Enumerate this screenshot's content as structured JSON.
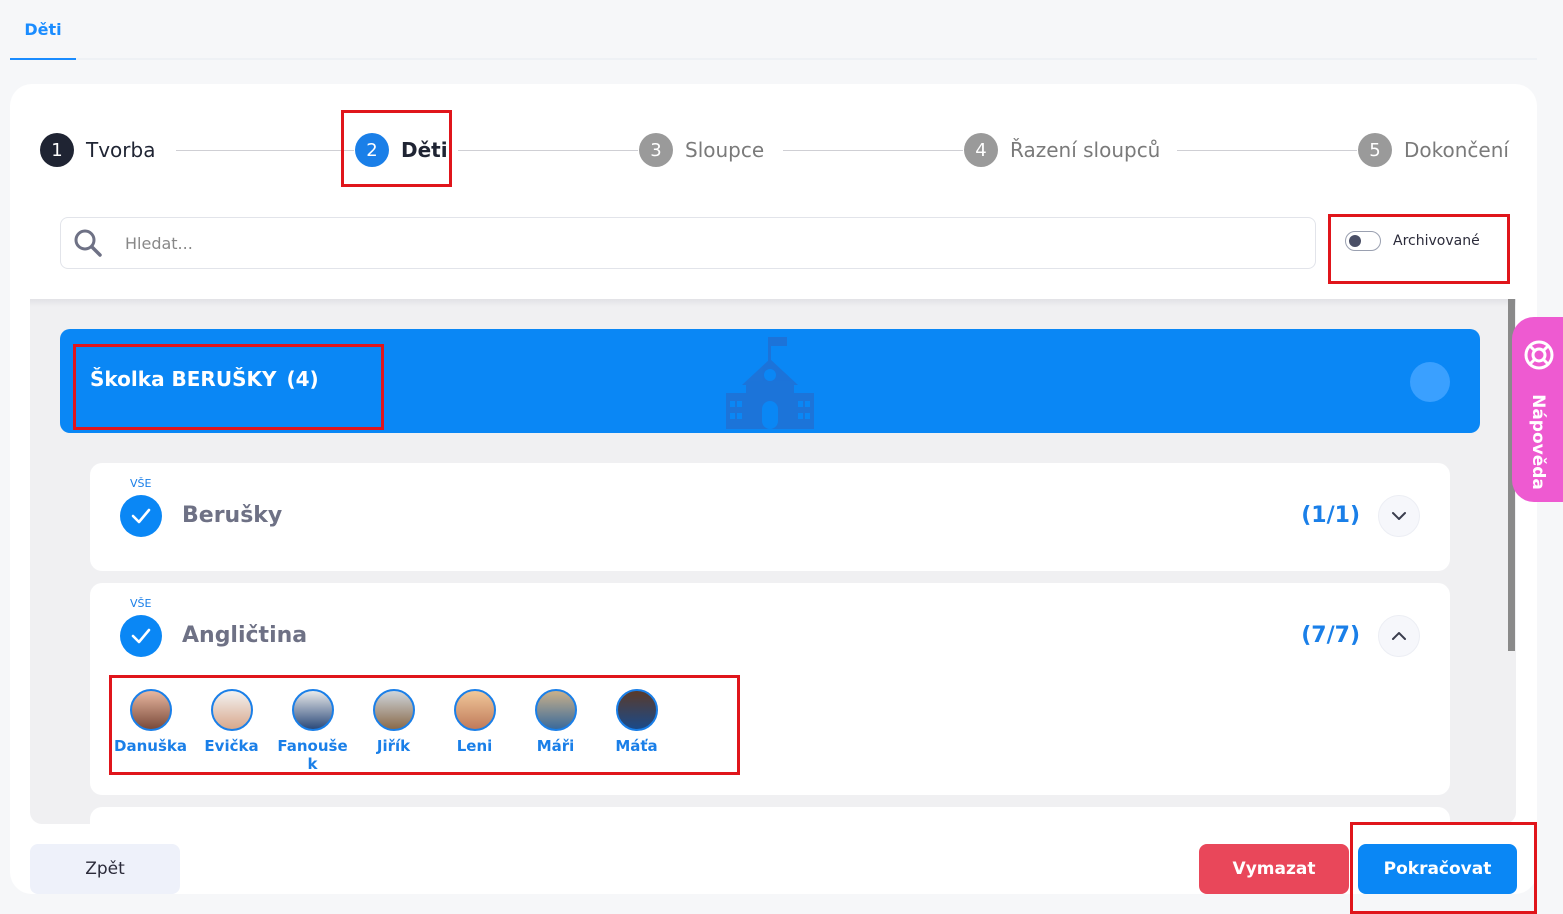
{
  "top_tab": {
    "label": "Děti"
  },
  "stepper": {
    "steps": [
      {
        "num": "1",
        "label": "Tvorba"
      },
      {
        "num": "2",
        "label": "Děti"
      },
      {
        "num": "3",
        "label": "Sloupce"
      },
      {
        "num": "4",
        "label": "Řazení sloupců"
      },
      {
        "num": "5",
        "label": "Dokončení"
      }
    ],
    "active_step": 2
  },
  "search": {
    "placeholder": "Hledat..."
  },
  "archive_toggle": {
    "label": "Archivované",
    "on": false
  },
  "school": {
    "name": "Školka BERUŠKY",
    "count": "(4)"
  },
  "groups": [
    {
      "all_label": "VŠE",
      "name": "Berušky",
      "count": "(1/1)",
      "expanded": false
    },
    {
      "all_label": "VŠE",
      "name": "Angličtina",
      "count": "(7/7)",
      "expanded": true,
      "children": [
        "Danuška",
        "Evička",
        "Fanoušek",
        "Jiřík",
        "Leni",
        "Máři",
        "Máťa"
      ]
    }
  ],
  "buttons": {
    "back": "Zpět",
    "clear": "Vymazat",
    "continue": "Pokračovat"
  },
  "help": {
    "label": "Nápověda"
  },
  "colors": {
    "accent": "#0a87f5",
    "danger": "#e9475a",
    "help": "#ee5ad1",
    "highlight": "#e0151b"
  }
}
